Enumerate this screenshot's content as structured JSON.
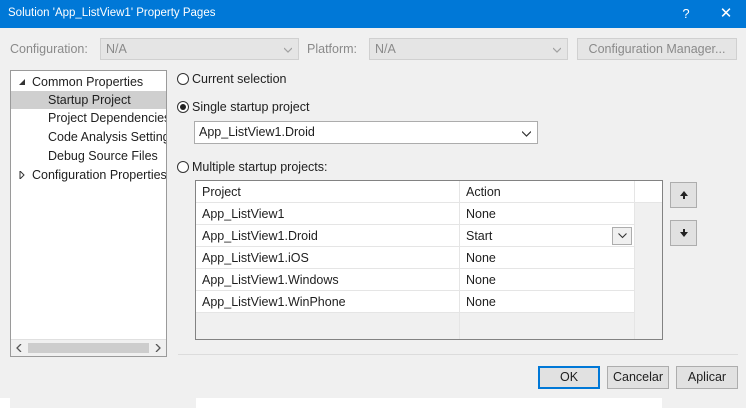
{
  "window": {
    "title": "Solution 'App_ListView1' Property Pages",
    "help_label": "?",
    "close_label": "✕"
  },
  "config_bar": {
    "configuration_label": "Configuration:",
    "configuration_value": "N/A",
    "platform_label": "Platform:",
    "platform_value": "N/A",
    "config_manager_label": "Configuration Manager..."
  },
  "tree": {
    "items": [
      {
        "label": "Common Properties",
        "expanded": true
      },
      {
        "label": "Startup Project",
        "selected": true
      },
      {
        "label": "Project Dependencies"
      },
      {
        "label": "Code Analysis Settings"
      },
      {
        "label": "Debug Source Files"
      },
      {
        "label": "Configuration Properties",
        "expanded": false
      }
    ]
  },
  "startup": {
    "current_selection_label": "Current selection",
    "single_label": "Single startup project",
    "single_value": "App_ListView1.Droid",
    "multiple_label": "Multiple startup projects:",
    "selected_option": "single"
  },
  "grid": {
    "columns": [
      "Project",
      "Action"
    ],
    "rows": [
      {
        "project": "App_ListView1",
        "action": "None"
      },
      {
        "project": "App_ListView1.Droid",
        "action": "Start"
      },
      {
        "project": "App_ListView1.iOS",
        "action": "None"
      },
      {
        "project": "App_ListView1.Windows",
        "action": "None"
      },
      {
        "project": "App_ListView1.WinPhone",
        "action": "None"
      }
    ]
  },
  "footer": {
    "ok_label": "OK",
    "cancel_label": "Cancelar",
    "apply_label": "Aplicar"
  },
  "colors": {
    "titlebar": "#0078d7",
    "selection": "#cfcfcf",
    "default_button_border": "#0078d7"
  }
}
